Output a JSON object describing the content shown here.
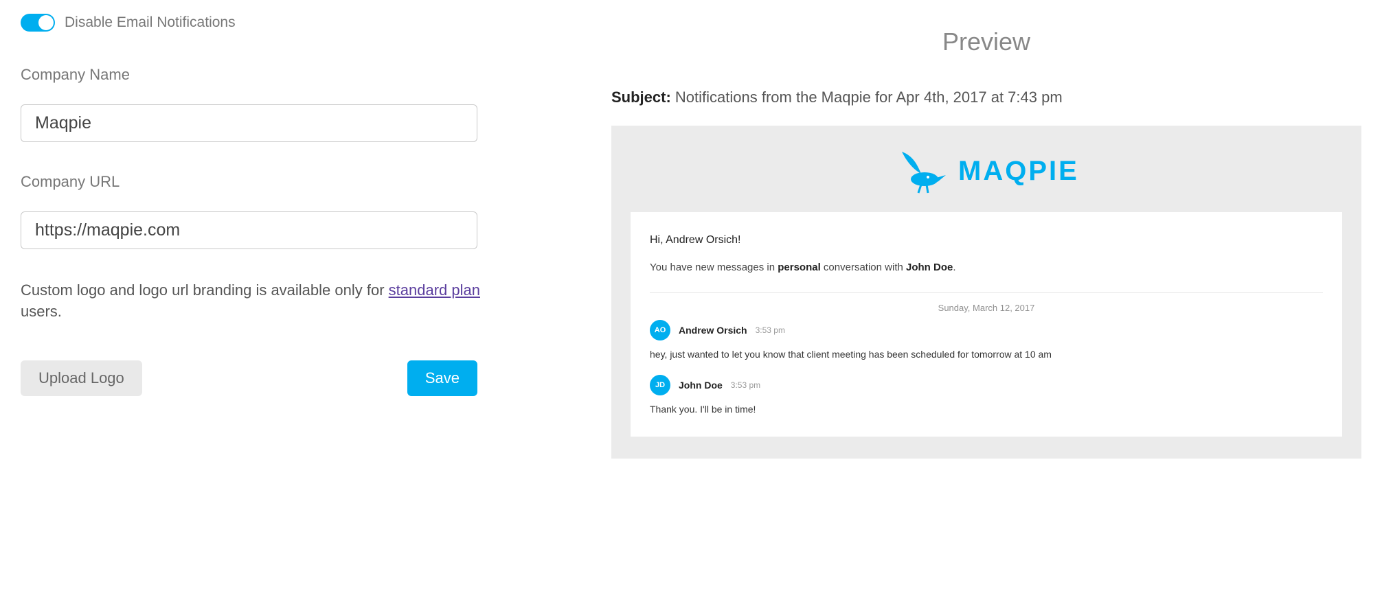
{
  "settings": {
    "disable_notifications_label": "Disable Email Notifications",
    "company_name_label": "Company Name",
    "company_name_value": "Maqpie",
    "company_url_label": "Company URL",
    "company_url_value": "https://maqpie.com",
    "helper_pre": "Custom logo and logo url branding is available only for ",
    "helper_link": "standard plan",
    "helper_post": " users.",
    "upload_logo_label": "Upload Logo",
    "save_label": "Save"
  },
  "preview": {
    "title": "Preview",
    "subject_label": "Subject:",
    "subject_value": "Notifications from the Maqpie for Apr 4th, 2017 at 7:43 pm",
    "logo_text": "MAQPIE",
    "greeting": "Hi, Andrew Orsich!",
    "intro_pre": "You have new messages in ",
    "intro_conv": "personal",
    "intro_mid": " conversation with ",
    "intro_user": "John Doe",
    "intro_post": ".",
    "date": "Sunday, March 12, 2017",
    "messages": [
      {
        "initials": "AO",
        "name": "Andrew Orsich",
        "time": "3:53 pm",
        "body": "hey, just wanted to let you know that client meeting has been scheduled for tomorrow at 10 am"
      },
      {
        "initials": "JD",
        "name": "John Doe",
        "time": "3:53 pm",
        "body": "Thank you. I'll be in time!"
      }
    ]
  }
}
